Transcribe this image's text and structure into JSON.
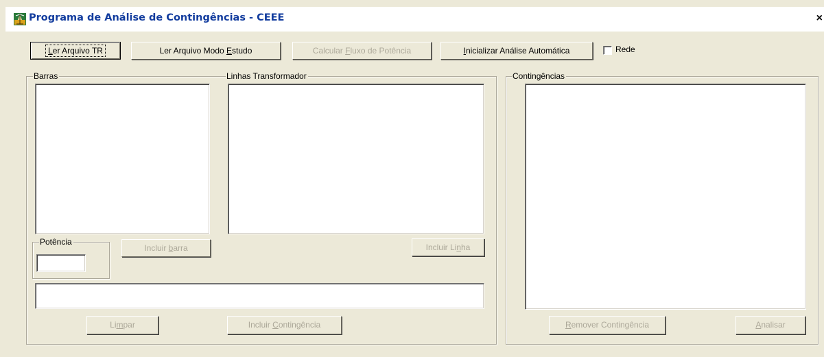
{
  "window": {
    "title": "Programa de Análise de Contingências - CEEE",
    "close_glyph": "×"
  },
  "toolbar": {
    "ler_tr": {
      "pre": "",
      "mn": "L",
      "post": "er Arquivo TR"
    },
    "ler_modo": {
      "pre": "Ler Arquivo Modo ",
      "mn": "E",
      "post": "studo"
    },
    "calcular": {
      "pre": "Calcular ",
      "mn": "F",
      "post": "luxo de Potência"
    },
    "inicializar": {
      "pre": "",
      "mn": "I",
      "post": "nicializar Análise Automática"
    },
    "rede_label": "Rede",
    "rede_checked": false
  },
  "barras": {
    "legend": "Barras",
    "items": [],
    "incluir": {
      "pre": "Incluir ",
      "mn": "b",
      "post": "arra"
    }
  },
  "potencia": {
    "legend": "Potência",
    "value": ""
  },
  "linhas": {
    "legend": "Linhas Transformador",
    "items": [],
    "incluir": {
      "pre": "Incluir Li",
      "mn": "n",
      "post": "ha"
    }
  },
  "contingencia_field": {
    "value": ""
  },
  "bottom": {
    "limpar": {
      "pre": "Li",
      "mn": "m",
      "post": "par"
    },
    "incluir_contingencia": {
      "pre": "Incluir ",
      "mn": "C",
      "post": "ontingência"
    }
  },
  "contingencias": {
    "legend": "Contingências",
    "items": [],
    "remover": {
      "pre": "",
      "mn": "R",
      "post": "emover Contingência"
    },
    "analisar": {
      "pre": "",
      "mn": "A",
      "post": "nalisar"
    }
  },
  "colors": {
    "title_text": "#123c9e",
    "dialog_bg": "#ece9d8",
    "disabled_text": "#aca899"
  }
}
